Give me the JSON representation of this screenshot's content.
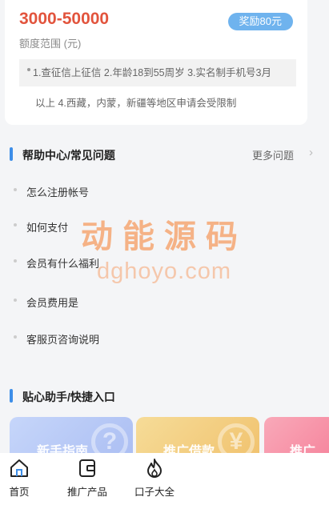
{
  "credit": {
    "amount": "3000-50000",
    "range_label": "额度范围 (元)",
    "reward_badge": "奖励80元",
    "requirements_line1": "1.查征信上征信 2.年龄18到55周岁 3.实名制手机号3月",
    "requirements_line2": "以上 4.西藏，内蒙，新疆等地区申请会受限制"
  },
  "help": {
    "title": "帮助中心/常见问题",
    "more_label": "更多问题",
    "items": [
      "怎么注册帐号",
      "如何支付",
      "会员有什么福利",
      "会员费用是",
      "客服页咨询说明"
    ]
  },
  "watermark": {
    "cn": "动能源码",
    "en": "dghoyo.com"
  },
  "shortcuts": {
    "title": "贴心助手/快捷入口",
    "items": [
      "新手指南",
      "推广借款",
      "推广"
    ]
  },
  "tabbar": {
    "items": [
      "首页",
      "推广产品",
      "口子大全"
    ]
  },
  "colors": {
    "accent_blue": "#3d8ee8",
    "amount_red": "#e2543d",
    "badge_blue": "#6fb3ee"
  }
}
